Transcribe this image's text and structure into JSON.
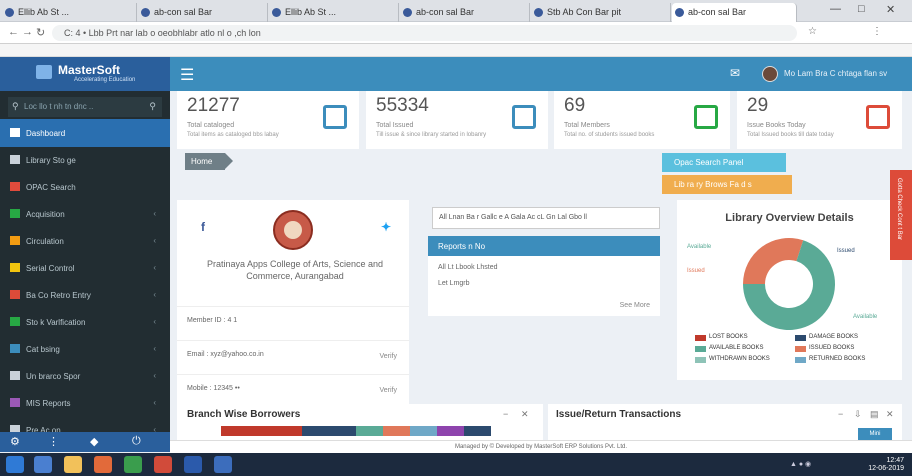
{
  "browser": {
    "tabs": [
      {
        "label": "Ellib Ab St ..."
      },
      {
        "label": "ab-con sal Bar"
      },
      {
        "label": "Ellib Ab St ..."
      },
      {
        "label": "ab-con sal Bar"
      },
      {
        "label": "Stb Ab Con Bar pit"
      },
      {
        "label": "ab-con sal Bar"
      }
    ],
    "url": "C: 4 • Lbb Prt nar lab o oeobhlabr atlo nl o ,ch lon"
  },
  "header": {
    "logo_name": "MasterSoft",
    "logo_sub": "Accelerating Education",
    "user_name": "Mo Lam Bra C chtaga flan sv"
  },
  "sidebar": {
    "search_placeholder": "Loc llo t nh tn dnc ..",
    "items": [
      {
        "label": "Dashboard",
        "color": "#ffffff"
      },
      {
        "label": "Library Sto ge",
        "color": "#c9d1d9"
      },
      {
        "label": "OPAC Search",
        "color": "#e04b3c"
      },
      {
        "label": "Acquisition",
        "color": "#27a844"
      },
      {
        "label": "Circulation",
        "color": "#f39c12"
      },
      {
        "label": "Serial Control",
        "color": "#f1c40f"
      },
      {
        "label": "Ba Co Retro Entry",
        "color": "#dd4b39"
      },
      {
        "label": "Sto k Varlfication",
        "color": "#27a844"
      },
      {
        "label": "Cat bsing",
        "color": "#3c8dbc"
      },
      {
        "label": "Un brarco Spor",
        "color": "#c9d1d9"
      },
      {
        "label": "MIS Reports",
        "color": "#9b59b6"
      },
      {
        "label": "Pre Ac on",
        "color": "#c9d1d9"
      }
    ]
  },
  "info_boxes": [
    {
      "number": "21277",
      "label": "Total cataloged",
      "desc": "Total items as cataloged bbs labay",
      "color": "#3c8dbc"
    },
    {
      "number": "55334",
      "label": "Total Issued",
      "desc": "Till issue & since library started in lobanry",
      "color": "#3c8dbc"
    },
    {
      "number": "69",
      "label": "Total Members",
      "desc": "Total no. of students issued books",
      "color": "#27a844"
    },
    {
      "number": "29",
      "label": "Issue Books Today",
      "desc": "Total Issued books till date today",
      "color": "#dd4b39"
    }
  ],
  "breadcrumb": {
    "home": "Home"
  },
  "quick_buttons": [
    {
      "label": "Opac Search Panel",
      "color": "#5bc0de"
    },
    {
      "label": "Lib ra ry Brows Fa d s",
      "color": "#f0ad4e"
    }
  ],
  "profile": {
    "college": "Pratinaya Apps College of Arts, Science and Commerce, Aurangabad",
    "rows": [
      {
        "label": "Member ID :  4 1 ",
        "right": ""
      },
      {
        "label": "Email : xyz@yahoo.co.in",
        "right": "Verify"
      },
      {
        "label": "Mobile : 12345 •• ",
        "right": "Verify"
      }
    ]
  },
  "middle": {
    "select_value": "All Lnan Ba r Gallc e A Gala Ac cL Gn Lal Gbo ll",
    "active_item": "Reports n No",
    "items": [
      "All Lt Lbook Lhsted",
      "Let Lmgrb"
    ],
    "more": "See More"
  },
  "donut": {
    "title": "Library Overview Details",
    "segments": [
      {
        "label": "Issued",
        "value": 30,
        "color": "#e0785a"
      },
      {
        "label": "Available",
        "value": 70,
        "color": "#5aaa96"
      }
    ],
    "legend": [
      {
        "label": "LOST BOOKS",
        "color": "#c0392b"
      },
      {
        "label": "DAMAGE BOOKS",
        "color": "#2c4a6e"
      },
      {
        "label": "AVAILABLE BOOKS",
        "color": "#5aaa96"
      },
      {
        "label": "ISSUED BOOKS",
        "color": "#e0785a"
      },
      {
        "label": "WITHDRAWN BOOKS",
        "color": "#8ec3b7"
      },
      {
        "label": "RETURNED BOOKS",
        "color": "#6fa8c7"
      }
    ],
    "label_left": "Available",
    "label_right": "Issued",
    "label_left2": "Issued",
    "label_bottom": "Available"
  },
  "branch": {
    "title": "Branch Wise Borrowers"
  },
  "issue": {
    "title": "Issue/Return Transactions"
  },
  "footer": {
    "text": "Managed by © Developed by MasterSoft ERP Solutions Pvt. Ltd.",
    "button": "Mini"
  },
  "sidetab": {
    "label": "Gotta Check Cont t  Bar"
  },
  "taskbar": {
    "time": "12:47",
    "date": "12-06-2019"
  }
}
